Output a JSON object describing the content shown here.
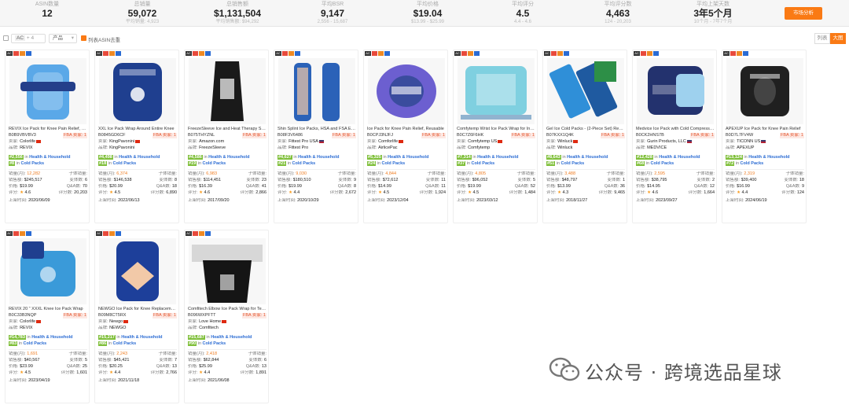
{
  "stats": [
    {
      "label": "ASIN数量",
      "value": "12",
      "sub": ""
    },
    {
      "label": "总销量",
      "value": "59,072",
      "sub": "平均销量: 4,923"
    },
    {
      "label": "总销售额",
      "value": "$1,131,504",
      "sub": "平均销售额: $94,292"
    },
    {
      "label": "平均BSR",
      "value": "9,147",
      "sub": "2,556 - 15,687"
    },
    {
      "label": "平均价格",
      "value": "$19.04",
      "sub": "$13.99 - $25.99"
    },
    {
      "label": "平均评分",
      "value": "4.5",
      "sub": "4.4 - 4.6"
    },
    {
      "label": "平均评分数",
      "value": "4,463",
      "sub": "124 - 20,203"
    },
    {
      "label": "平均上架天数",
      "value": "3年5个月",
      "sub": "10个月 - 7年7个月"
    }
  ],
  "analyze_button": "市场分析",
  "filter": {
    "ac_chip": "AC",
    "ac_count": "+ 4",
    "product_select": "产品",
    "list_asin_label": "列表ASIN去重",
    "view_list": "列表",
    "view_grid": "大图"
  },
  "labels": {
    "seller": "卖家:",
    "brand": "品牌:",
    "in": "in",
    "sales_month": "销量(月):",
    "sales_amount": "销售额:",
    "price": "价格:",
    "rating": "评分:",
    "sub_sales": "子体销量:",
    "variants": "变体数:",
    "qa": "Q&A数:",
    "reviews": "评分数:",
    "listed": "上架时间:",
    "fba": "FBA 卖家: 1"
  },
  "products": [
    {
      "title": "REVIX Ice Pack for Knee Pain Relief, Reusable Gel",
      "asin": "B0B9VBVBV3",
      "seller": "Colorlife",
      "flag": "cn",
      "brand": "REVIX",
      "rank_main": "#2,556",
      "main_cat": "Health & Household",
      "rank_sub": "#8",
      "sub_cat": "Cold Packs",
      "sales": "12,282",
      "sub_sales": "",
      "amount": "$245,517",
      "variants": "6",
      "price": "$19.99",
      "qa": "70",
      "rating": "4.6",
      "reviews": "20,203",
      "date": "2020/06/09",
      "tags": [
        "AC",
        "r",
        "o",
        "b"
      ],
      "color": "#5aa8e8"
    },
    {
      "title": "XXL Ice Pack Wrap Around Entire Knee",
      "asin": "B0845GD6CF",
      "seller": "KingPavonini",
      "flag": "cn",
      "brand": "KingPavonini",
      "rank_main": "#4,498",
      "main_cat": "Health & Household",
      "rank_sub": "#18",
      "sub_cat": "Cold Packs",
      "sales": "6,374",
      "sub_sales": "",
      "amount": "$146,538",
      "variants": "8",
      "price": "$20.99",
      "qa": "18",
      "rating": "4.5",
      "reviews": "6,890",
      "date": "2022/06/13",
      "tags": [
        "AC",
        "r",
        "o",
        "b"
      ],
      "color": "#1f3f8f"
    },
    {
      "title": "FreezeSleeve Ice and Heat Therapy Sleeve",
      "asin": "B075THYZNL",
      "seller": "Amazon.com",
      "flag": "",
      "brand": "FreezeSleeve",
      "rank_main": "#4,586",
      "main_cat": "Health & Household",
      "rank_sub": "#19",
      "sub_cat": "Cold Packs",
      "sales": "6,983",
      "sub_sales": "",
      "amount": "$114,451",
      "variants": "23",
      "price": "$16.39",
      "qa": "41",
      "rating": "4.6",
      "reviews": "2,866",
      "date": "2017/09/20",
      "tags": [
        "AC",
        "r",
        "o",
        "b"
      ],
      "color": "#1a1a1a"
    },
    {
      "title": "Shin Splint Ice Packs, HSA and FSA Eligible",
      "asin": "B08F3V6486",
      "seller": "Fittest Pro USA",
      "flag": "us",
      "brand": "Fittest Pro",
      "rank_main": "#4,627",
      "main_cat": "Health & Household",
      "rank_sub": "#21",
      "sub_cat": "Cold Packs",
      "sales": "9,030",
      "sub_sales": "",
      "amount": "$180,510",
      "variants": "9",
      "price": "$19.99",
      "qa": "8",
      "rating": "4.4",
      "reviews": "2,672",
      "date": "2020/10/29",
      "tags": [
        "AC",
        "r",
        "o",
        "b"
      ],
      "color": "#2b62b8"
    },
    {
      "title": "Ice Pack for Knee Pain Relief, Reusable",
      "asin": "B0CPJ3NJFJ",
      "seller": "Comforlife",
      "flag": "cn",
      "brand": "AirlicePac",
      "rank_main": "#5,325",
      "main_cat": "Health & Household",
      "rank_sub": "#24",
      "sub_cat": "Cold Packs",
      "sales": "4,844",
      "sub_sales": "",
      "amount": "$72,612",
      "variants": "11",
      "price": "$14.99",
      "qa": "11",
      "rating": "4.5",
      "reviews": "1,924",
      "date": "2023/12/04",
      "tags": [
        "AC",
        "r",
        "o",
        "b"
      ],
      "color": "#3a4c9e"
    },
    {
      "title": "Comfytemp Wrist Ice Pack Wrap for Injuries",
      "asin": "B0C7Z6F6HK",
      "seller": "Comfytemp US",
      "flag": "cn",
      "brand": "Comfytemp",
      "rank_main": "#7,314",
      "main_cat": "Health & Household",
      "rank_sub": "#37",
      "sub_cat": "Cold Packs",
      "sales": "4,805",
      "sub_sales": "",
      "amount": "$96,052",
      "variants": "5",
      "price": "$19.99",
      "qa": "52",
      "rating": "4.5",
      "reviews": "1,484",
      "date": "2023/03/12",
      "tags": [
        "AC",
        "r",
        "o",
        "b"
      ],
      "color": "#7fd0e0"
    },
    {
      "title": "Gel Ice Cold Packs - (2-Piece Set) Reusable",
      "asin": "B07KXX1Q4K",
      "seller": "Winluck",
      "flag": "cn",
      "brand": "Winluck",
      "rank_main": "#8,643",
      "main_cat": "Health & Household",
      "rank_sub": "#51",
      "sub_cat": "Cold Packs",
      "sales": "3,488",
      "sub_sales": "",
      "amount": "$48,797",
      "variants": "1",
      "price": "$13.99",
      "qa": "36",
      "rating": "4.3",
      "reviews": "9,465",
      "date": "2018/11/27",
      "tags": [
        "AC",
        "r",
        "o",
        "b"
      ],
      "color": "#2f8fd8"
    },
    {
      "title": "Medvice Ice Pack with Cold Compression",
      "asin": "B0CK2HNS7B",
      "seller": "Gurin Products, LLC",
      "flag": "us",
      "brand": "MEDVICE",
      "rank_main": "#12,428",
      "main_cat": "Health & Household",
      "rank_sub": "#68",
      "sub_cat": "Cold Packs",
      "sales": "2,595",
      "sub_sales": "",
      "amount": "$38,795",
      "variants": "2",
      "price": "$14.95",
      "qa": "12",
      "rating": "4.6",
      "reviews": "1,664",
      "date": "2023/09/27",
      "tags": [
        "AC",
        "r",
        "o",
        "b"
      ],
      "color": "#23326e"
    },
    {
      "title": "APEXUP Ice Pack for Knee Pain Relief",
      "asin": "B0D7L7FV4W",
      "seller": "TICONN US",
      "flag": "us",
      "brand": "APEXUP",
      "rank_main": "#13,124",
      "main_cat": "Health & Household",
      "rank_sub": "#72",
      "sub_cat": "Cold Packs",
      "sales": "2,319",
      "sub_sales": "",
      "amount": "$39,400",
      "variants": "18",
      "price": "$16.99",
      "qa": "9",
      "rating": "4.4",
      "reviews": "124",
      "date": "2024/06/19",
      "tags": [
        "AC",
        "r",
        "o",
        "b"
      ],
      "color": "#202020"
    },
    {
      "title": "REVIX 20 \" XXXL Knee Ice Pack Wrap",
      "asin": "B0C33B3NQP",
      "seller": "Colorlife",
      "flag": "cn",
      "brand": "REVIX",
      "rank_main": "#14,783",
      "main_cat": "Health & Household",
      "rank_sub": "#83",
      "sub_cat": "Cold Packs",
      "sales": "1,691",
      "sub_sales": "",
      "amount": "$40,567",
      "variants": "5",
      "price": "$23.99",
      "qa": "25",
      "rating": "4.5",
      "reviews": "1,601",
      "date": "2023/04/19",
      "tags": [
        "AC",
        "r",
        "o",
        "b"
      ],
      "color": "#3a9ad9"
    },
    {
      "title": "NEWGO Ice Pack for Knee Replacement Surgery",
      "asin": "B09M8CT5RX",
      "seller": "Newgo",
      "flag": "cn",
      "brand": "NEWGO",
      "rank_main": "#15,217",
      "main_cat": "Health & Household",
      "rank_sub": "#86",
      "sub_cat": "Cold Packs",
      "sales": "2,243",
      "sub_sales": "",
      "amount": "$45,421",
      "variants": "7",
      "price": "$20.25",
      "qa": "13",
      "rating": "4.4",
      "reviews": "2,766",
      "date": "2021/11/18",
      "tags": [
        "AC",
        "r",
        "o",
        "b"
      ],
      "color": "#1d3f9a"
    },
    {
      "title": "Comfitech Elbow Ice Pack Wrap for Tendonitis",
      "asin": "B096WXPFTT",
      "seller": "Love Home",
      "flag": "cn",
      "brand": "Comfitech",
      "rank_main": "#15,687",
      "main_cat": "Health & Household",
      "rank_sub": "#90",
      "sub_cat": "Cold Packs",
      "sales": "2,418",
      "sub_sales": "",
      "amount": "$62,844",
      "variants": "6",
      "price": "$25.99",
      "qa": "13",
      "rating": "4.4",
      "reviews": "1,891",
      "date": "2021/06/08",
      "tags": [
        "AC",
        "r",
        "o",
        "b"
      ],
      "color": "#151515"
    }
  ],
  "watermark": "公众号 · 跨境选品星球"
}
